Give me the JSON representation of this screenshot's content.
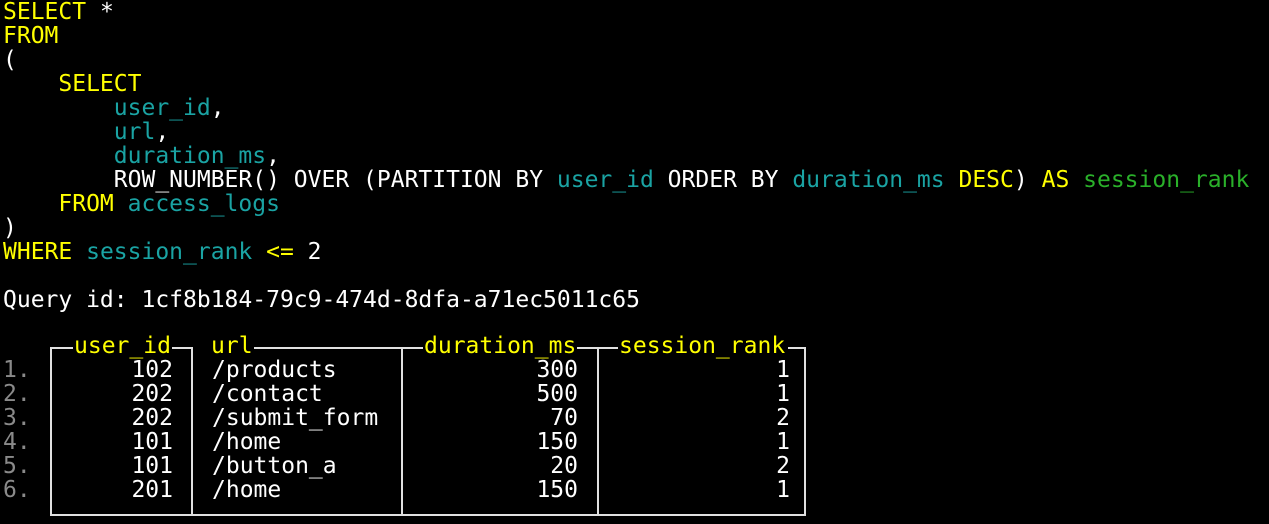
{
  "sql": {
    "l1_select": "SELECT",
    "l1_star": " *",
    "l2_from": "FROM",
    "l3_paren": "(",
    "l4_select": "SELECT",
    "l5_col": "user_id",
    "l5_comma": ",",
    "l6_col": "url",
    "l6_comma": ",",
    "l7_col": "duration_ms",
    "l7_comma": ",",
    "l8_fn": "ROW_NUMBER() OVER (PARTITION BY ",
    "l8_part_col": "user_id",
    "l8_order": " ORDER BY ",
    "l8_order_col": "duration_ms",
    "l8_desc": " DESC",
    "l8_close": ") ",
    "l8_as": "AS",
    "l8_alias": " session_rank",
    "l9_from": "FROM",
    "l9_table": " access_logs",
    "l10_paren": ")",
    "l11_where": "WHERE",
    "l11_col": " session_rank",
    "l11_op": " <=",
    "l11_val": " 2"
  },
  "query_id_text": "Query id: 1cf8b184-79c9-474d-8dfa-a71ec5011c65",
  "table": {
    "headers": [
      "user_id",
      "url",
      "duration_ms",
      "session_rank"
    ],
    "rows": [
      {
        "num": "1.",
        "user_id": "102",
        "url": "/products",
        "duration_ms": "300",
        "session_rank": "1"
      },
      {
        "num": "2.",
        "user_id": "202",
        "url": "/contact",
        "duration_ms": "500",
        "session_rank": "1"
      },
      {
        "num": "3.",
        "user_id": "202",
        "url": "/submit_form",
        "duration_ms": "70",
        "session_rank": "2"
      },
      {
        "num": "4.",
        "user_id": "101",
        "url": "/home",
        "duration_ms": "150",
        "session_rank": "1"
      },
      {
        "num": "5.",
        "user_id": "101",
        "url": "/button_a",
        "duration_ms": "20",
        "session_rank": "2"
      },
      {
        "num": "6.",
        "user_id": "201",
        "url": "/home",
        "duration_ms": "150",
        "session_rank": "1"
      }
    ]
  },
  "colors": {
    "keyword": "#ffff00",
    "identifier": "#1aa3a3",
    "alias": "#2ab02a",
    "text": "#ffffff",
    "row_number": "#8a8a8a",
    "background": "#000000"
  }
}
